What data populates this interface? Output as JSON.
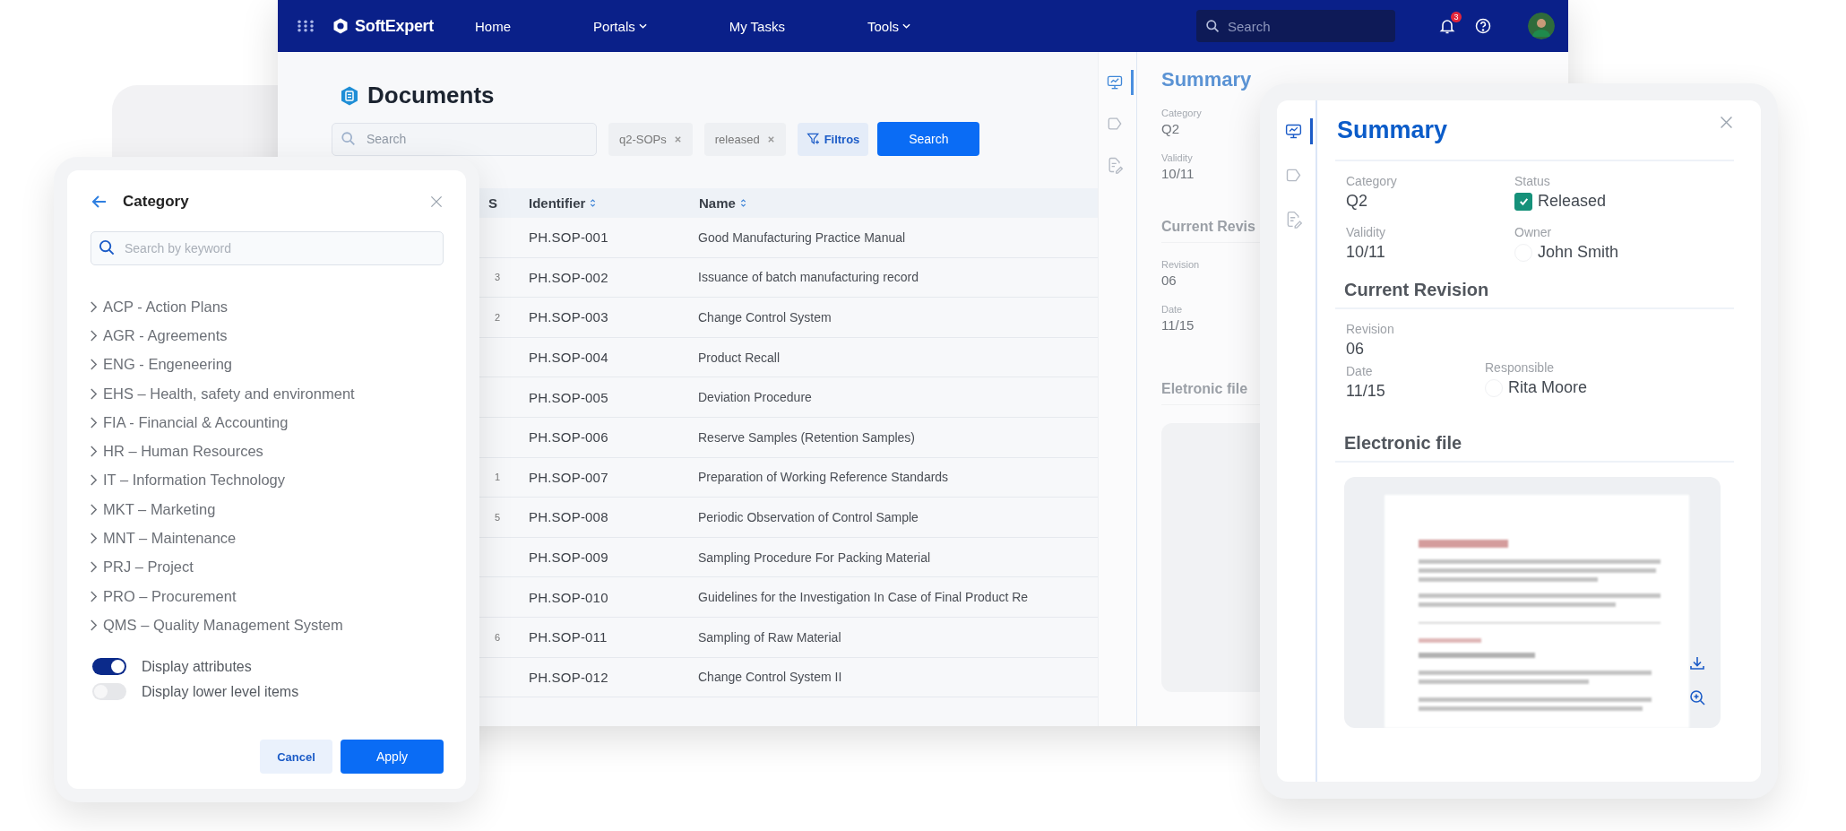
{
  "nav": {
    "logo": "SoftExpert",
    "items": [
      {
        "label": "Home",
        "dropdown": false
      },
      {
        "label": "Portals",
        "dropdown": true
      },
      {
        "label": "My Tasks",
        "dropdown": false
      },
      {
        "label": "Tools",
        "dropdown": true
      }
    ],
    "search_placeholder": "Search",
    "notifications": "3"
  },
  "documents": {
    "title": "Documents",
    "search_placeholder": "Search",
    "chips": [
      "q2-SOPs",
      "released"
    ],
    "filter_button": "Filtros",
    "search_button": "Search",
    "table": {
      "columns": [
        {
          "label": "S",
          "sortable": false
        },
        {
          "label": "Identifier",
          "sortable": true
        },
        {
          "label": "Name",
          "sortable": true
        }
      ],
      "rows": [
        {
          "identifier": "PH.SOP-001",
          "name": "Good Manufacturing Practice Manual"
        },
        {
          "s": "3",
          "identifier": "PH.SOP-002",
          "name": "Issuance of batch manufacturing record"
        },
        {
          "s": "2",
          "identifier": "PH.SOP-003",
          "name": "Change Control System"
        },
        {
          "identifier": "PH.SOP-004",
          "name": "Product Recall"
        },
        {
          "identifier": "PH.SOP-005",
          "name": "Deviation Procedure"
        },
        {
          "identifier": "PH.SOP-006",
          "name": "Reserve Samples (Retention Samples)"
        },
        {
          "s": "1",
          "identifier": "PH.SOP-007",
          "name": "Preparation of Working Reference Standards"
        },
        {
          "s": "5",
          "identifier": "PH.SOP-008",
          "name": "Periodic Observation of Control Sample"
        },
        {
          "identifier": "PH.SOP-009",
          "name": "Sampling Procedure For Packing Material"
        },
        {
          "identifier": "PH.SOP-010",
          "name": "Guidelines for the Investigation In Case of Final Product Re"
        },
        {
          "s": "6",
          "identifier": "PH.SOP-011",
          "name": "Sampling of Raw Material"
        },
        {
          "identifier": "PH.SOP-012",
          "name": "Change Control System II"
        }
      ]
    }
  },
  "summary_panel": {
    "tabs": [
      {
        "kind": "overview",
        "selected": true
      },
      {
        "kind": "tag",
        "selected": false
      },
      {
        "kind": "document",
        "selected": false
      }
    ],
    "title": "Summary",
    "fields": [
      {
        "label": "Category",
        "value": "Q2"
      },
      {
        "label": "Validity",
        "value": "10/11"
      }
    ],
    "revision_heading": "Current Revis",
    "revision_fields": [
      {
        "label": "Revision",
        "value": "06"
      },
      {
        "label": "Date",
        "value": "11/15"
      }
    ],
    "file_heading": "Eletronic file"
  },
  "summary_card": {
    "tabs": [
      {
        "kind": "overview",
        "selected": true
      },
      {
        "kind": "tag",
        "selected": false
      },
      {
        "kind": "document",
        "selected": false
      }
    ],
    "title": "Summary",
    "category": {
      "label": "Category",
      "value": "Q2"
    },
    "status": {
      "label": "Status",
      "value": "Released",
      "checked": true
    },
    "validity": {
      "label": "Validity",
      "value": "10/11"
    },
    "owner": {
      "label": "Owner",
      "value": "John Smith"
    },
    "revision_heading": "Current Revision",
    "revision": {
      "label": "Revision",
      "value": "06"
    },
    "date": {
      "label": "Date",
      "value": "11/15"
    },
    "responsible": {
      "label": "Responsible",
      "value": "Rita Moore"
    },
    "file_heading": "Electronic file"
  },
  "category_dialog": {
    "title": "Category",
    "search_placeholder": "Search by keyword",
    "items": [
      {
        "label": "ACP - Action Plans",
        "expanded": false
      },
      {
        "label": "AGR - Agreements",
        "expanded": false
      },
      {
        "label": "ENG - Engeneering",
        "expanded": false
      },
      {
        "label": "EHS – Health, safety and environment",
        "expanded": false
      },
      {
        "label": "FIA - Financial & Accounting",
        "expanded": false
      },
      {
        "label": "HR – Human Resources",
        "expanded": false
      },
      {
        "label": "IT – Information Technology",
        "expanded": false
      },
      {
        "label": "MKT – Marketing",
        "expanded": false
      },
      {
        "label": "MNT – Maintenance",
        "expanded": false
      },
      {
        "label": "PRJ – Project",
        "expanded": false
      },
      {
        "label": "PRO – Procurement",
        "expanded": false
      },
      {
        "label": "QMS – Quality Management System",
        "expanded": false
      }
    ],
    "toggles": [
      {
        "label": "Display attributes",
        "on": true
      },
      {
        "label": "Display lower level items",
        "on": false
      }
    ],
    "cancel": "Cancel",
    "apply": "Apply"
  }
}
